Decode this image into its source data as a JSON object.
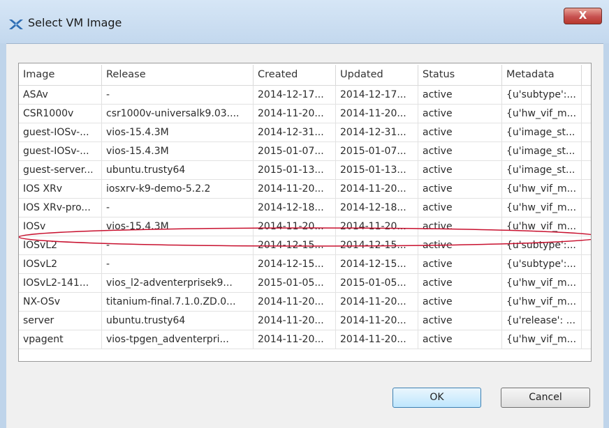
{
  "window": {
    "title": "Select VM Image",
    "close_label": "X"
  },
  "table": {
    "columns": [
      "Image",
      "Release",
      "Created",
      "Updated",
      "Status",
      "Metadata"
    ],
    "rows": [
      [
        "ASAv",
        "-",
        "2014-12-17...",
        "2014-12-17...",
        "active",
        "{u'subtype':..."
      ],
      [
        "CSR1000v",
        "csr1000v-universalk9.03....",
        "2014-11-20...",
        "2014-11-20...",
        "active",
        "{u'hw_vif_m..."
      ],
      [
        "guest-IOSv-...",
        "vios-15.4.3M",
        "2014-12-31...",
        "2014-12-31...",
        "active",
        "{u'image_st..."
      ],
      [
        "guest-IOSv-...",
        "vios-15.4.3M",
        "2015-01-07...",
        "2015-01-07...",
        "active",
        "{u'image_st..."
      ],
      [
        "guest-server...",
        "ubuntu.trusty64",
        "2015-01-13...",
        "2015-01-13...",
        "active",
        "{u'image_st..."
      ],
      [
        "IOS XRv",
        "iosxrv-k9-demo-5.2.2",
        "2014-11-20...",
        "2014-11-20...",
        "active",
        "{u'hw_vif_m..."
      ],
      [
        "IOS XRv-pro...",
        "-",
        "2014-12-18...",
        "2014-12-18...",
        "active",
        "{u'hw_vif_m..."
      ],
      [
        "IOSv",
        "vios-15.4.3M",
        "2014-11-20...",
        "2014-11-20...",
        "active",
        "{u'hw_vif_m..."
      ],
      [
        "IOSvL2",
        "-",
        "2014-12-15...",
        "2014-12-15...",
        "active",
        "{u'subtype':..."
      ],
      [
        "IOSvL2",
        "-",
        "2014-12-15...",
        "2014-12-15...",
        "active",
        "{u'subtype':..."
      ],
      [
        "IOSvL2-141...",
        "vios_l2-adventerprisek9...",
        "2015-01-05...",
        "2015-01-05...",
        "active",
        "{u'hw_vif_m..."
      ],
      [
        "NX-OSv",
        "titanium-final.7.1.0.ZD.0...",
        "2014-11-20...",
        "2014-11-20...",
        "active",
        "{u'hw_vif_m..."
      ],
      [
        "server",
        "ubuntu.trusty64",
        "2014-11-20...",
        "2014-11-20...",
        "active",
        "{u'release': ..."
      ],
      [
        "vpagent",
        "vios-tpgen_adventerpri...",
        "2014-11-20...",
        "2014-11-20...",
        "active",
        "{u'hw_vif_m..."
      ]
    ],
    "highlighted_row": 4,
    "highlight_color": "#c8102e"
  },
  "buttons": {
    "ok_label": "OK",
    "cancel_label": "Cancel"
  },
  "colors": {
    "window_frame": "#bfd4ea",
    "close_button": "#c75050",
    "ok_button_border": "#3c7fb1"
  }
}
